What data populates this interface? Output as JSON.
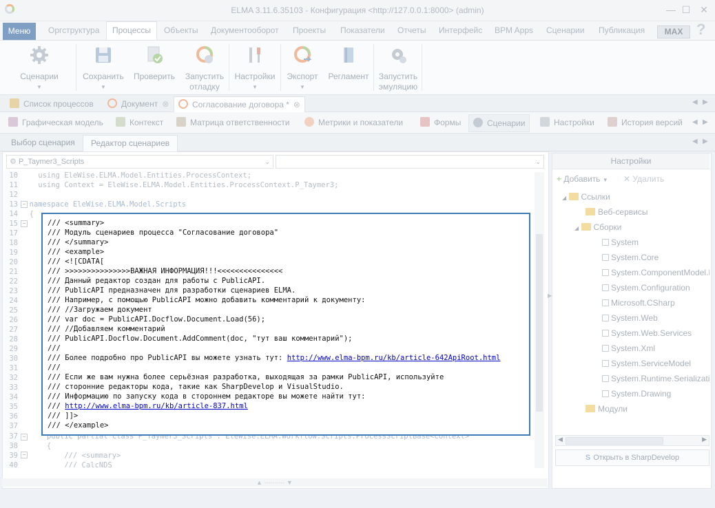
{
  "window": {
    "title": "ELMA 3.11.6.35103 - Конфигурация <http://127.0.0.1:8000> (admin)",
    "controls": [
      "—",
      "☐",
      "✕"
    ]
  },
  "menubar": {
    "menu_label": "Меню",
    "items": [
      "Оргструктура",
      "Процессы",
      "Объекты",
      "Документооборот",
      "Проекты",
      "Показатели",
      "Отчеты",
      "Интерфейс",
      "BPM Apps",
      "Сценарии",
      "Публикация"
    ],
    "active": "Процессы",
    "max_label": "MAX",
    "help": "?"
  },
  "ribbon": {
    "buttons": [
      {
        "label": "Сценарии",
        "label2": "",
        "icon": "gear-icon"
      },
      {
        "label": "Сохранить",
        "label2": "",
        "icon": "save-icon"
      },
      {
        "label": "Проверить",
        "label2": "",
        "icon": "check-doc-icon"
      },
      {
        "label": "Запустить",
        "label2": "отладку",
        "icon": "debug-icon"
      },
      {
        "label": "Настройки",
        "label2": "",
        "icon": "tools-icon"
      },
      {
        "label": "Экспорт",
        "label2": "",
        "icon": "export-icon"
      },
      {
        "label": "Регламент",
        "label2": "",
        "icon": "book-icon"
      },
      {
        "label": "Запустить",
        "label2": "эмуляцию",
        "icon": "emulation-icon"
      }
    ]
  },
  "doc_tabs": [
    "Список процессов",
    "Документ",
    "Согласование договора *"
  ],
  "sub_tabs": [
    "Графическая модель",
    "Контекст",
    "Матрица ответственности",
    "Метрики и показатели",
    "Формы",
    "Сценарии",
    "Настройки",
    "История версий"
  ],
  "editor_tabs": [
    "Выбор сценария",
    "Редактор сценариев"
  ],
  "editor": {
    "class_combo": "P_Taymer3_Scripts",
    "method_combo": "",
    "lines_before": [
      {
        "n": "10",
        "t": "    using EleWise.ELMA.Model.Entities.ProcessContext;"
      },
      {
        "n": "11",
        "t": "    using Context = EleWise.ELMA.Model.Entities.ProcessContext.P_Taymer3;"
      },
      {
        "n": "12",
        "t": ""
      },
      {
        "n": "13",
        "t": "  namespace EleWise.ELMA.Model.Scripts"
      },
      {
        "n": "14",
        "t": "  {"
      },
      {
        "n": "15",
        "t": ""
      }
    ],
    "highlighted_lines": [
      {
        "n": "16",
        "t": "/// <summary>"
      },
      {
        "n": "17",
        "t": "/// Модуль сценариев процесса \"Согласование договора\""
      },
      {
        "n": "18",
        "t": "/// </summary>"
      },
      {
        "n": "19",
        "t": "/// <example>"
      },
      {
        "n": "20",
        "t": "/// <![CDATA["
      },
      {
        "n": "21",
        "t": "/// >>>>>>>>>>>>>>>ВАЖНАЯ ИНФОРМАЦИЯ!!!<<<<<<<<<<<<<<<"
      },
      {
        "n": "22",
        "t": "/// Данный редактор создан для работы с PublicAPI."
      },
      {
        "n": "23",
        "t": "/// PublicAPI предназначен для разработки сценариев ELMA."
      },
      {
        "n": "24",
        "t": "/// Например, с помощью PublicAPI можно добавить комментарий к документу:"
      },
      {
        "n": "25",
        "t": "/// //Загружаем документ"
      },
      {
        "n": "26",
        "t": "/// var doc = PublicAPI.Docflow.Document.Load(56);"
      },
      {
        "n": "27",
        "t": "/// //Добавляем комментарий"
      },
      {
        "n": "28",
        "t": "/// PublicAPI.Docflow.Document.AddComment(doc, \"тут ваш комментарий\");"
      },
      {
        "n": "29",
        "t": "///"
      },
      {
        "n": "30",
        "t": "/// Более подробно про PublicAPI вы можете узнать тут: ",
        "link": "http://www.elma-bpm.ru/kb/article-642ApiRoot.html"
      },
      {
        "n": "31",
        "t": "///"
      },
      {
        "n": "32",
        "t": "/// Если же вам нужна более серьёзная разработка, выходящая за рамки PublicAPI, используйте"
      },
      {
        "n": "33",
        "t": "/// сторонние редакторы кода, такие как SharpDevelop и VisualStudio."
      },
      {
        "n": "34",
        "t": "/// Информацию по запуску кода в стороннем редакторе вы можете найти тут:"
      },
      {
        "n": "35",
        "t": "/// ",
        "link": "http://www.elma-bpm.ru/kb/article-837.html"
      },
      {
        "n": "36",
        "t": "/// ]]>"
      },
      {
        "n": "37",
        "t": "/// </example>"
      }
    ],
    "lines_after": [
      {
        "n": "37",
        "t": "      public partial class P_Taymer3_Scripts : EleWise.ELMA.Workflow.Scripts.ProcessScriptBase<Context>"
      },
      {
        "n": "38",
        "t": "      {"
      },
      {
        "n": "39",
        "t": "          /// <summary>"
      },
      {
        "n": "40",
        "t": "          /// CalcNDS"
      }
    ]
  },
  "settings_panel": {
    "title": "Настройки",
    "add_label": "Добавить",
    "remove_label": "Удалить",
    "tree": {
      "root": "Ссылки",
      "web_services": "Веб-сервисы",
      "assemblies": "Сборки",
      "assembly_items": [
        "System",
        "System.Core",
        "System.ComponentModel.D",
        "System.Configuration",
        "Microsoft.CSharp",
        "System.Web",
        "System.Web.Services",
        "System.Xml",
        "System.ServiceModel",
        "System.Runtime.Serializatio",
        "System.Drawing"
      ],
      "modules": "Модули"
    },
    "open_button": "Открыть в SharpDevelop"
  }
}
